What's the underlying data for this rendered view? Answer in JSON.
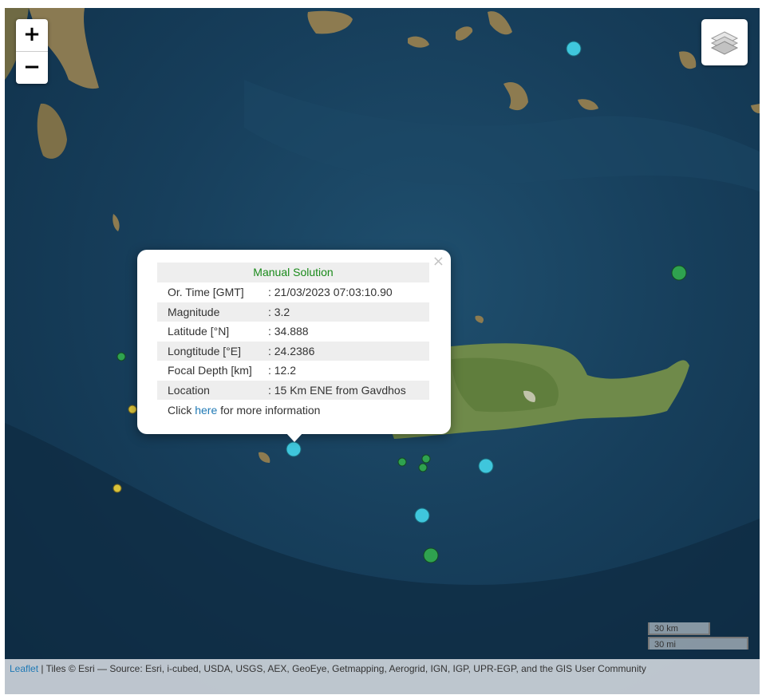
{
  "controls": {
    "zoom_in": "+",
    "zoom_out": "−",
    "layers_icon": "layers-icon"
  },
  "popup": {
    "title": "Manual Solution",
    "close": "×",
    "rows": [
      {
        "label": "Or. Time [GMT]",
        "value": ": 21/03/2023 07:03:10.90"
      },
      {
        "label": "Magnitude",
        "value": ": 3.2"
      },
      {
        "label": "Latitude [°N]",
        "value": ": 34.888"
      },
      {
        "label": "Longtitude [°E]",
        "value": ": 24.2386"
      },
      {
        "label": "Focal Depth [km]",
        "value": ": 12.2"
      },
      {
        "label": "Location",
        "value": ": 15 Km ENE from Gavdhos"
      }
    ],
    "click_prefix": "Click ",
    "click_link": "here",
    "click_suffix": " for more information"
  },
  "scale": {
    "km": "30 km",
    "mi": "30 mi"
  },
  "attribution": {
    "leaflet": "Leaflet",
    "text": " | Tiles © Esri — Source: Esri, i-cubed, USDA, USGS, AEX, GeoEye, Getmapping, Aerogrid, IGN, IGP, UPR-EGP, and the GIS User Community"
  },
  "marker_colors": {
    "cyan": "#3fc6dc",
    "green": "#2fa24f",
    "yellow": "#d9c23a"
  }
}
